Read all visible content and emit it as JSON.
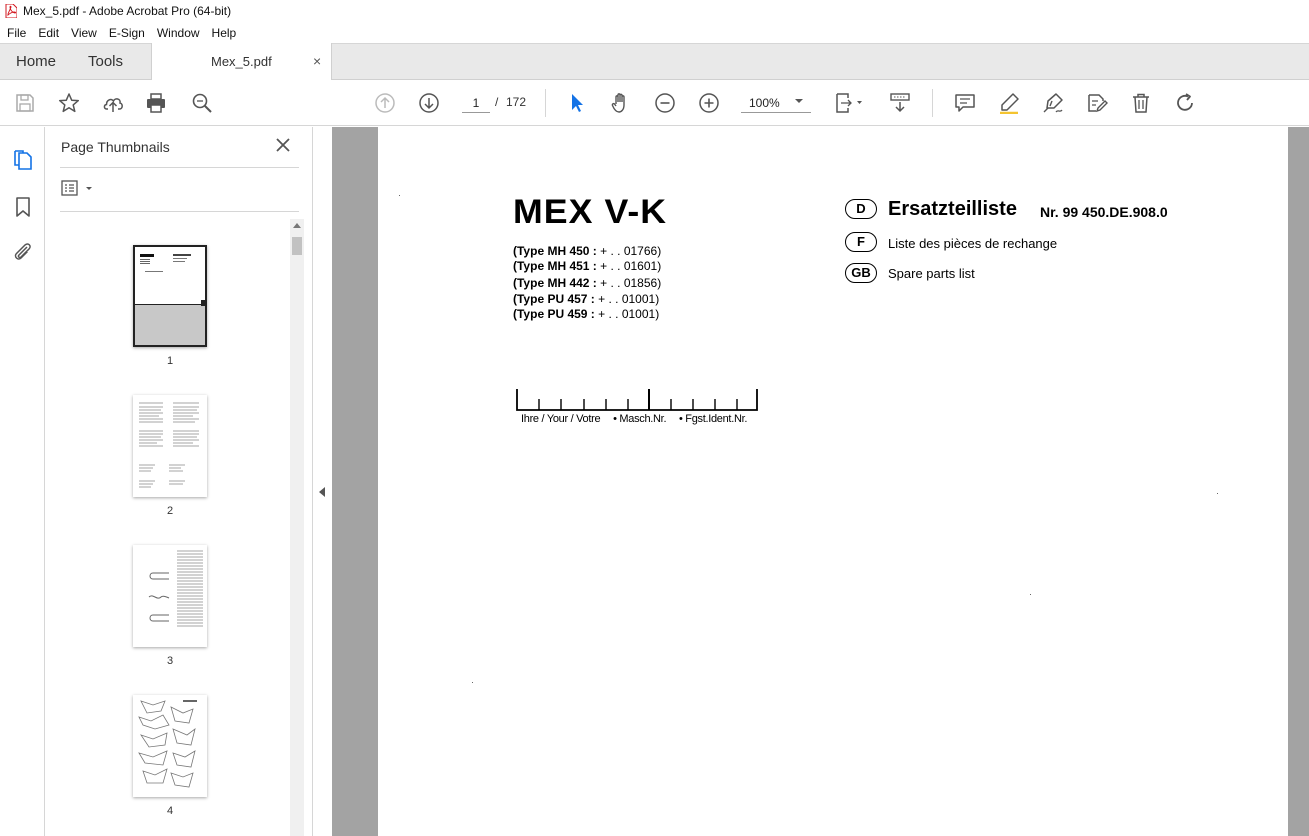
{
  "window": {
    "title": "Mex_5.pdf - Adobe Acrobat Pro (64-bit)"
  },
  "menu": [
    "File",
    "Edit",
    "View",
    "E-Sign",
    "Window",
    "Help"
  ],
  "tabs": {
    "home": "Home",
    "tools": "Tools",
    "document": "Mex_5.pdf",
    "close": "×"
  },
  "toolbar": {
    "page_current": "1",
    "page_separator": "/",
    "page_total": "172",
    "zoom": "100%"
  },
  "panel": {
    "title": "Page Thumbnails",
    "thumbnails": [
      {
        "label": "1"
      },
      {
        "label": "2"
      },
      {
        "label": "3"
      },
      {
        "label": "4"
      }
    ]
  },
  "document": {
    "title": "MEX V-K",
    "types": [
      {
        "label": "(Type MH 450 :",
        "value": "+ . . 01766)"
      },
      {
        "label": "(Type MH 451 :",
        "value": "+ . . 01601)"
      },
      {
        "label": "(Type MH 442 :",
        "value": "+ . . 01856)"
      },
      {
        "label": "(Type PU 457 :",
        "value": "+ . . 01001)"
      },
      {
        "label": "(Type PU 459 :",
        "value": "+ . . 01001)"
      }
    ],
    "languages": [
      {
        "code": "D",
        "text": "Ersatzteilliste",
        "number": "Nr. 99 450.DE.908.0"
      },
      {
        "code": "F",
        "text": "Liste des pièces de rechange"
      },
      {
        "code": "GB",
        "text": "Spare parts list"
      }
    ],
    "ruler_labels": [
      "Ihre / Your / Votre",
      "• Masch.Nr.",
      "• Fgst.Ident.Nr."
    ]
  }
}
